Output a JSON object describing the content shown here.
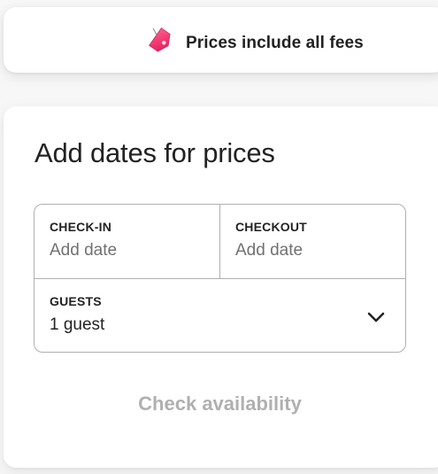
{
  "banner": {
    "icon": "price-tag-icon",
    "text": "Prices include all fees",
    "tag_color": "#e61e4d"
  },
  "booking": {
    "title": "Add dates for prices",
    "check_in": {
      "label": "CHECK-IN",
      "value": "Add date"
    },
    "checkout": {
      "label": "CHECKOUT",
      "value": "Add date"
    },
    "guests": {
      "label": "GUESTS",
      "value": "1 guest",
      "icon": "chevron-down-icon"
    },
    "button_label": "Check availability",
    "button_disabled": true
  }
}
